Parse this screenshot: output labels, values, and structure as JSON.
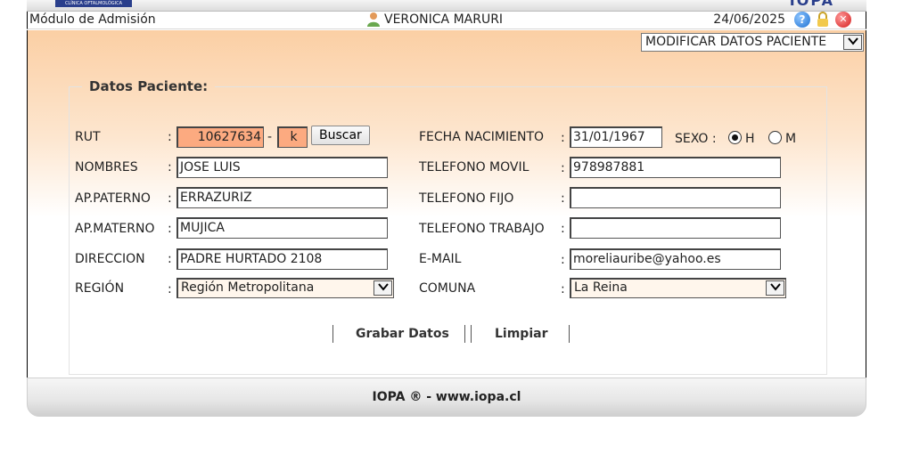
{
  "branding": {
    "clinic_tag": "CLÍNICA OFTALMOLÓGICA",
    "logo_text": "IOPA"
  },
  "header": {
    "module": "Módulo de Admisión",
    "user": "VERONICA MARURI",
    "date": "24/06/2025",
    "icons": [
      "user-icon",
      "help-icon",
      "lock-icon",
      "close-icon"
    ]
  },
  "mode_select": {
    "value": "MODIFICAR DATOS PACIENTE"
  },
  "form": {
    "legend": "Datos Paciente:",
    "rut": {
      "label": "RUT",
      "value": "10627634",
      "dv": "k",
      "dash": "-",
      "button": "Buscar"
    },
    "nombres": {
      "label": "NOMBRES",
      "value": "JOSE LUIS"
    },
    "ap_paterno": {
      "label": "AP.PATERNO",
      "value": "ERRAZURIZ"
    },
    "ap_materno": {
      "label": "AP.MATERNO",
      "value": "MUJICA"
    },
    "direccion": {
      "label": "DIRECCION",
      "value": "PADRE HURTADO  2108"
    },
    "region": {
      "label": "REGIÓN",
      "value": "Región Metropolitana"
    },
    "fecha_nacimiento": {
      "label": "FECHA NACIMIENTO",
      "value": "31/01/1967"
    },
    "sexo": {
      "label": "SEXO :",
      "option_h": "H",
      "option_m": "M",
      "selected": "H"
    },
    "telefono_movil": {
      "label": "TELEFONO MOVIL",
      "value": "978987881"
    },
    "telefono_fijo": {
      "label": "TELEFONO FIJO",
      "value": ""
    },
    "telefono_trabajo": {
      "label": "TELEFONO TRABAJO",
      "value": ""
    },
    "email": {
      "label": "E-MAIL",
      "value": "moreliauribe@yahoo.es"
    },
    "comuna": {
      "label": "COMUNA",
      "value": "La Reina"
    },
    "colon": ":"
  },
  "actions": {
    "save": "Grabar Datos",
    "clear": "Limpiar"
  },
  "footer": {
    "text": "IOPA ®  - www.iopa.cl"
  },
  "colors": {
    "rut_bg": "#fcaa80",
    "gradient_top": "#fbcfa4"
  }
}
